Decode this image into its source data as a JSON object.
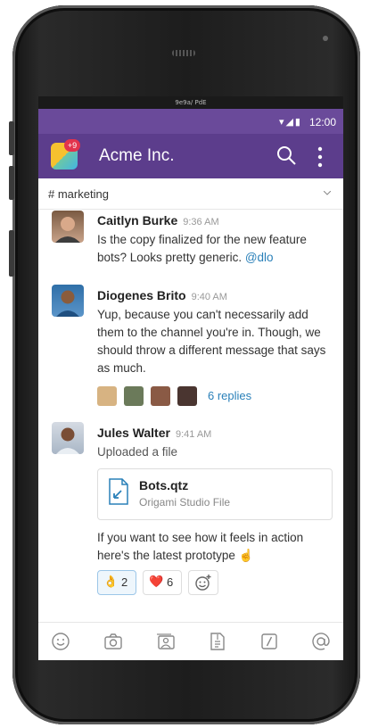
{
  "device": {
    "notch_text": "9e9a/ PdE"
  },
  "status_bar": {
    "time": "12:00",
    "icons": "▾◢▮"
  },
  "app_bar": {
    "badge": "+9",
    "title": "Acme Inc."
  },
  "channel": {
    "name": "# marketing"
  },
  "messages": [
    {
      "author": "Caitlyn Burke",
      "time": "9:36 AM",
      "text": "Is the copy finalized for the new feature bots? Looks pretty generic. ",
      "mention": "@dlo"
    },
    {
      "author": "Diogenes Brito",
      "time": "9:40 AM",
      "text": "Yup, because you can't necessarily add them to the channel you're in. Though, we should throw a different message that says as much.",
      "replies": "6 replies"
    },
    {
      "author": "Jules Walter",
      "time": "9:41 AM",
      "text": "Uploaded a file",
      "file": {
        "name": "Bots.qtz",
        "type": "Origami Studio File"
      },
      "comment": "If you want to see how it feels in action here's the latest prototype ☝",
      "reactions": [
        {
          "emoji": "👌",
          "count": "2"
        },
        {
          "emoji": "❤️",
          "count": "6"
        }
      ]
    }
  ],
  "colors": {
    "header": "#5c3d8c",
    "statusbar": "#6a4a9a",
    "link": "#2a80b9",
    "badge": "#e2334d"
  }
}
